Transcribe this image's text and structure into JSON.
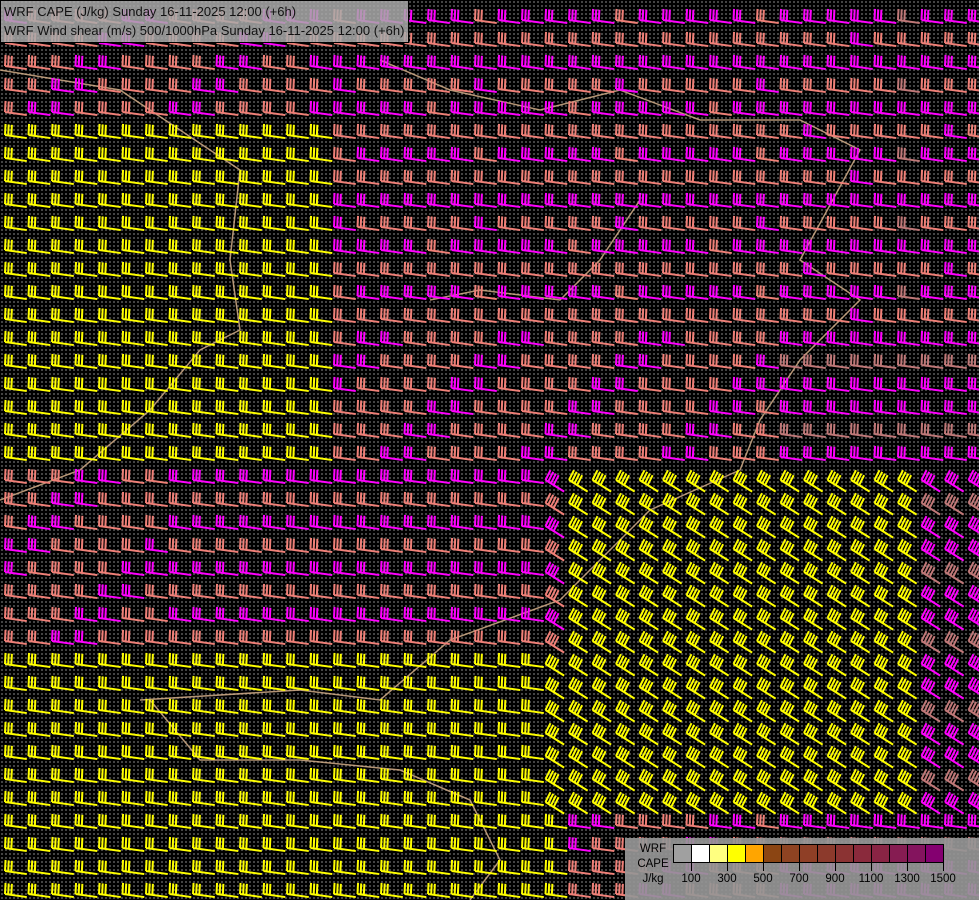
{
  "header": {
    "line1": "WRF CAPE (J/kg) Sunday 16-11-2025 12:00 (+6h)",
    "line2": "WRF Wind shear (m/s) 500/1000hPa Sunday 16-11-2025 12:00 (+6h)"
  },
  "legend": {
    "label_lines": [
      "WRF",
      "CAPE",
      "J/kg"
    ],
    "colors": [
      "#a0a0a0",
      "#ffffff",
      "#ffff80",
      "#ffff00",
      "#ffa500",
      "#8b4513",
      "#8e4322",
      "#8f3f26",
      "#8c3a2c",
      "#8b3333",
      "#8a2a3c",
      "#892444",
      "#861c52",
      "#84145e",
      "#840070"
    ],
    "tick_labels": [
      "100",
      "300",
      "500",
      "700",
      "900",
      "1100",
      "1300",
      "1500"
    ]
  },
  "barb_colors": {
    "low": "#ffff00",
    "mid": "#f08078",
    "high": "#ff00ff",
    "alt": "#c07878"
  }
}
